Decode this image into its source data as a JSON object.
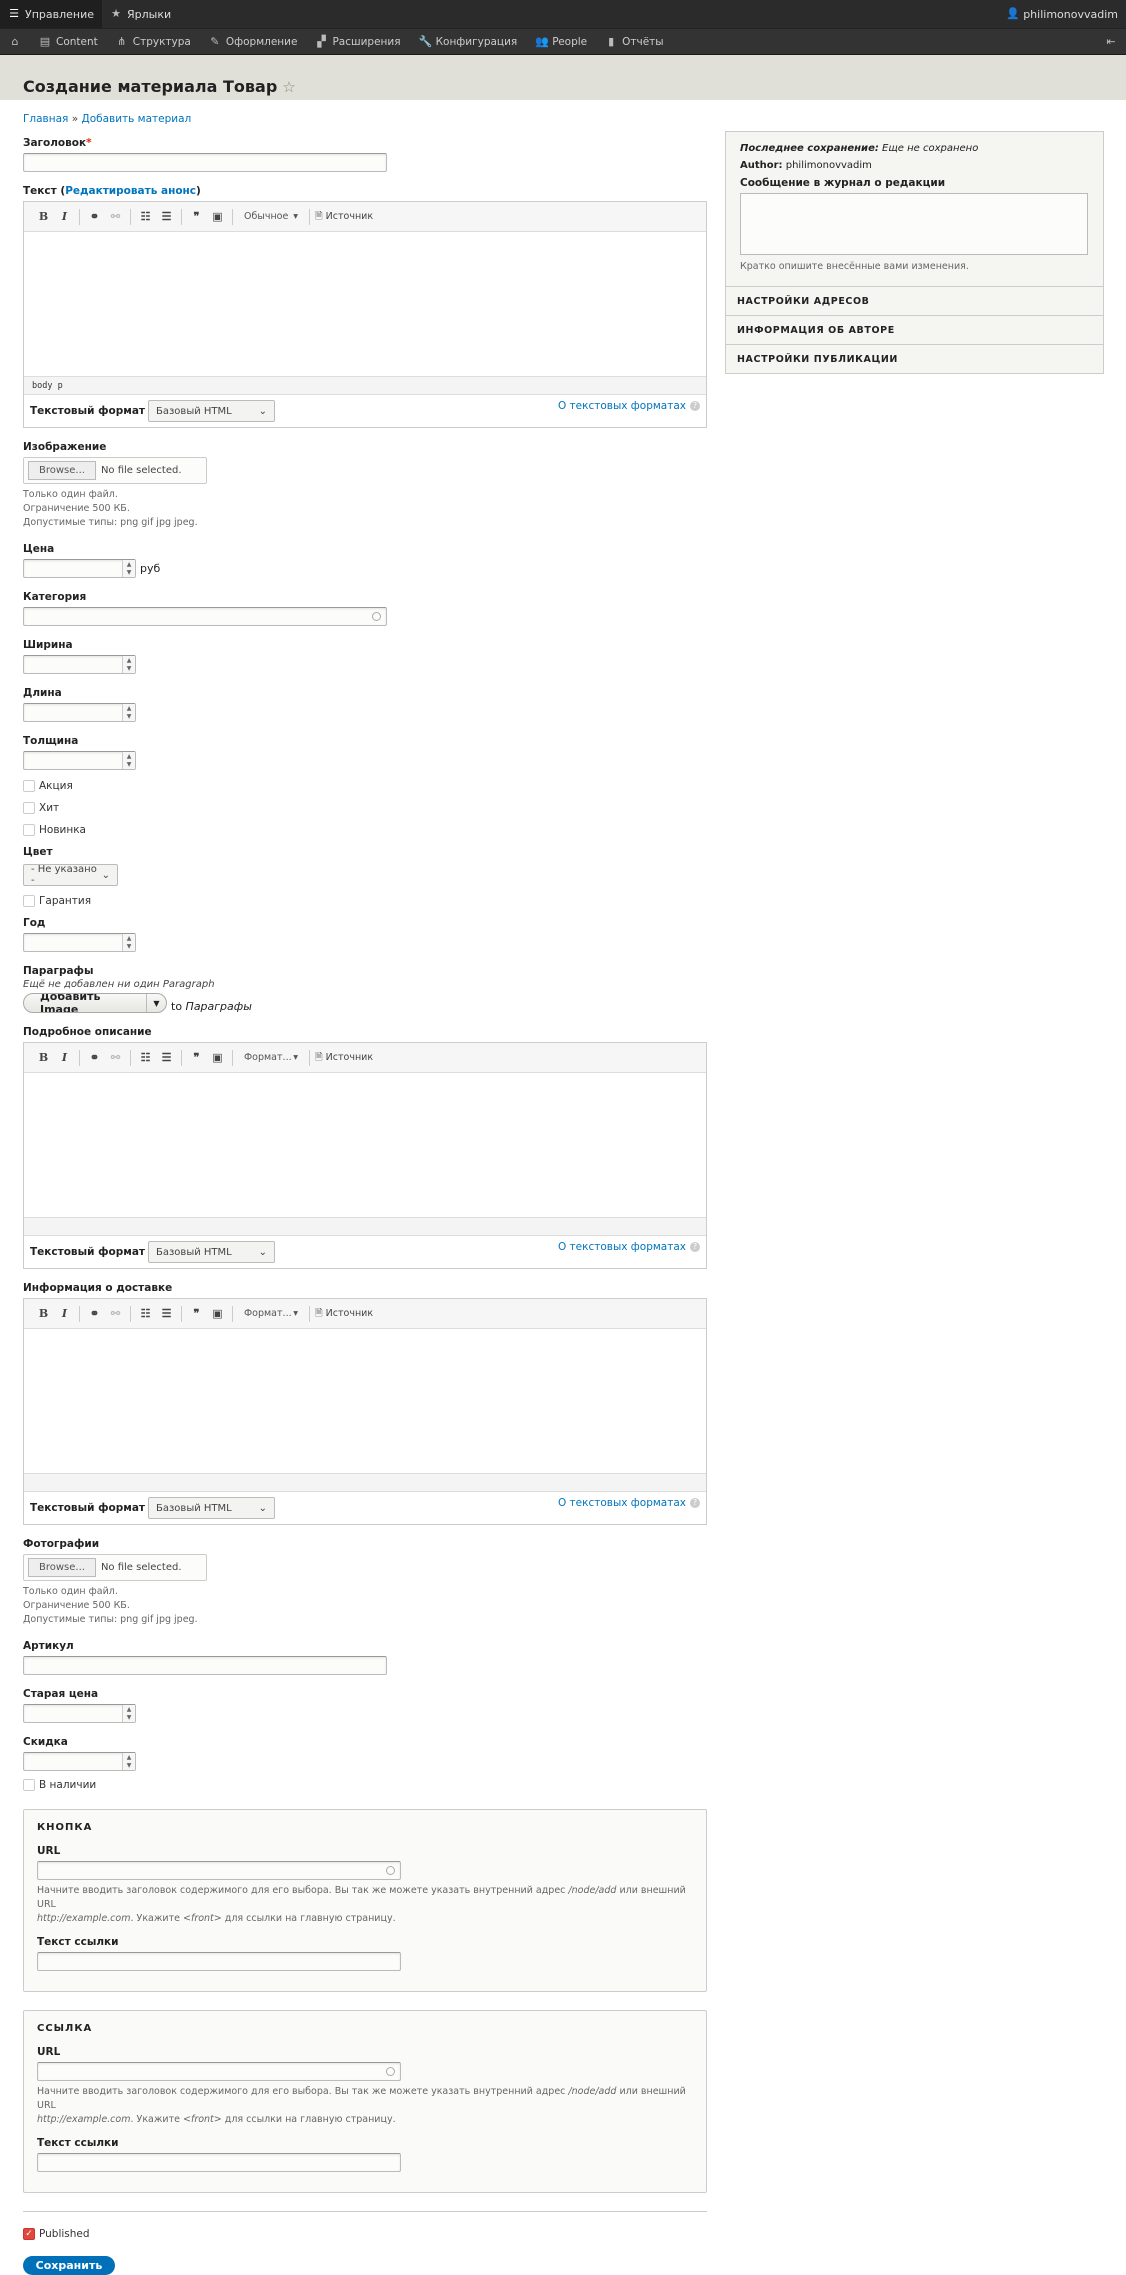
{
  "toolbar": {
    "manage": "Управление",
    "shortcuts": "Ярлыки",
    "user": "philimonovvadim"
  },
  "menu": [
    {
      "icon": "content-icon",
      "label": "Content"
    },
    {
      "icon": "structure-icon",
      "label": "Структура"
    },
    {
      "icon": "appearance-icon",
      "label": "Оформление"
    },
    {
      "icon": "extend-icon",
      "label": "Расширения"
    },
    {
      "icon": "config-icon",
      "label": "Конфигурация"
    },
    {
      "icon": "people-icon",
      "label": "People"
    },
    {
      "icon": "reports-icon",
      "label": "Отчёты"
    }
  ],
  "page": {
    "title": "Создание материала Товар"
  },
  "breadcrumb": {
    "home": "Главная",
    "sep": "»",
    "current": "Добавить материал"
  },
  "form": {
    "title_label": "Заголовок",
    "required_mark": "*",
    "body_label": "Текст",
    "body_summary_link": "Редактировать анонс",
    "paren_open": "(",
    "paren_close": ")",
    "image_label": "Изображение",
    "browse": "Browse...",
    "no_file": "No file selected.",
    "help_one": "Только один файл.",
    "help_limit": "Ограничение 500 КБ.",
    "help_types": "Допустимые типы: png gif jpg jpeg.",
    "price_label": "Цена",
    "price_suffix": "руб",
    "category_label": "Категория",
    "width_label": "Ширина",
    "length_label": "Длина",
    "thickness_label": "Толщина",
    "cb_sale": "Акция",
    "cb_hit": "Хит",
    "cb_new": "Новинка",
    "color_label": "Цвет",
    "color_value": "- Не указано -",
    "cb_warranty": "Гарантия",
    "year_label": "Год",
    "paragraphs_label": "Параграфы",
    "paragraphs_empty": "Ещё не добавлен ни один Paragraph",
    "add_image": "Добавить Image",
    "to_word": "to",
    "to_target": "Параграфы",
    "details_label": "Подробное описание",
    "delivery_label": "Информация о доставке",
    "photos_label": "Фотографии",
    "sku_label": "Артикул",
    "old_price_label": "Старая цена",
    "discount_label": "Скидка",
    "cb_in_stock": "В наличии",
    "fs_button": {
      "legend": "КНОПКА"
    },
    "fs_link": {
      "legend": "ССЫЛКА"
    },
    "url_label": "URL",
    "link_text_label": "Текст ссылки",
    "url_help_1": "Начните вводить заголовок содержимого для его выбора. Вы так же можете указать внутренний адрес ",
    "url_help_node": "/node/add",
    "url_help_2": " или внешний URL ",
    "url_help_ex": "http://example.com",
    "url_help_3": ". Укажите ",
    "url_help_front": "<front>",
    "url_help_4": " для ссылки на главную страницу.",
    "published": "Published",
    "published_checked": true,
    "save": "Сохранить"
  },
  "editors": [
    {
      "style": "Обычное",
      "source": "Источник",
      "path": "body  p",
      "format_label": "Текстовый формат",
      "format": "Базовый HTML",
      "about": "О текстовых форматах"
    },
    {
      "style": "Формат...",
      "source": "Источник",
      "path": "",
      "format_label": "Текстовый формат",
      "format": "Базовый HTML",
      "about": "О текстовых форматах"
    },
    {
      "style": "Формат...",
      "source": "Источник",
      "path": "",
      "format_label": "Текстовый формат",
      "format": "Базовый HTML",
      "about": "О текстовых форматах"
    }
  ],
  "sidebar": {
    "last_saved_label": "Последнее сохранение:",
    "last_saved_value": "Еще не сохранено",
    "author_label": "Author:",
    "author_value": "philimonovvadim",
    "log_label": "Сообщение в журнал о редакции",
    "log_help": "Кратко опишите внесённые вами изменения.",
    "sections": [
      "НАСТРОЙКИ АДРЕСОВ",
      "ИНФОРМАЦИЯ ОБ АВТОРЕ",
      "НАСТРОЙКИ ПУБЛИКАЦИИ"
    ]
  },
  "colors": {
    "toolbar": "#2b2b2b",
    "header": "#e0e0d8",
    "link": "#0074bd",
    "primary": "#0071b8",
    "required": "#e32700"
  }
}
